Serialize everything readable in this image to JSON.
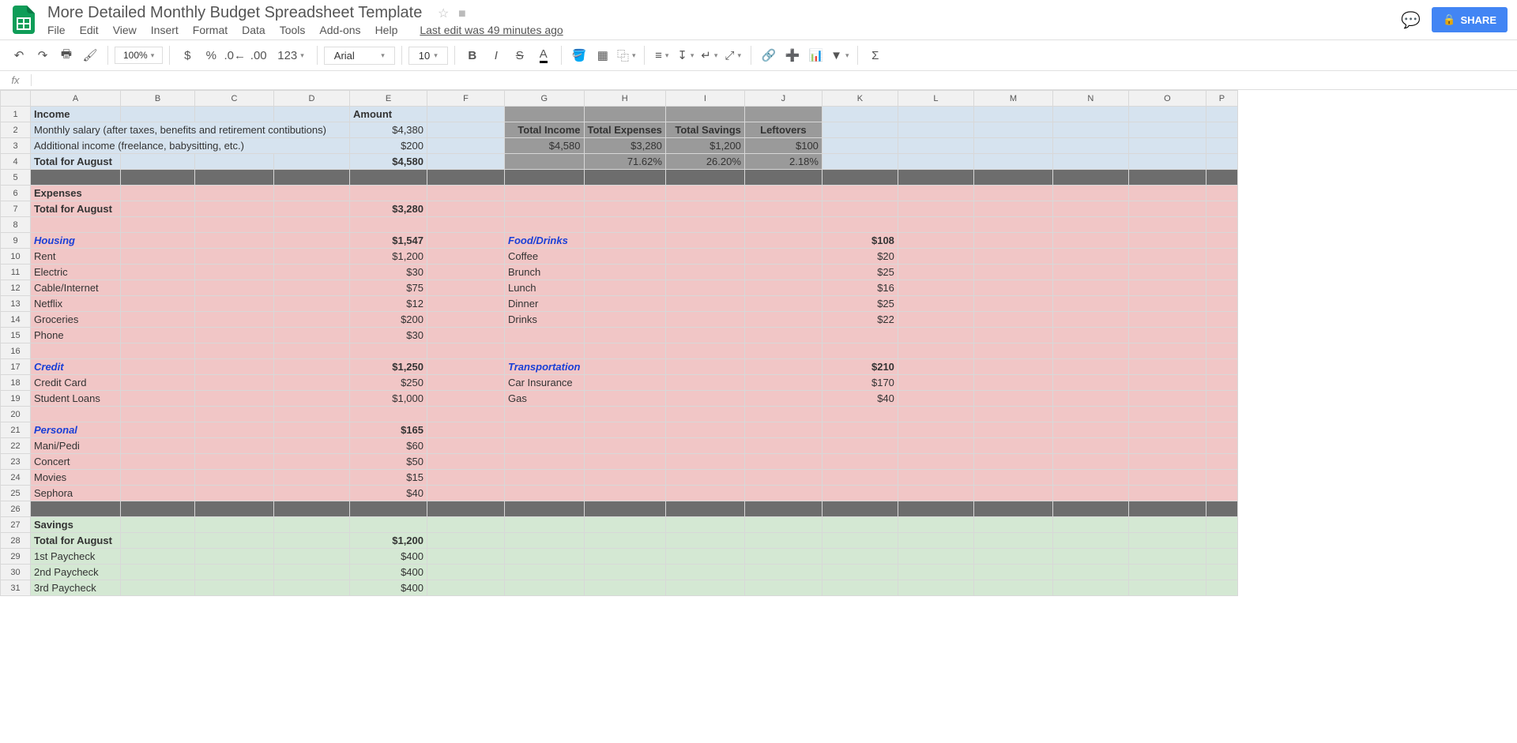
{
  "doc": {
    "title": "More Detailed Monthly Budget Spreadsheet Template",
    "last_edit": "Last edit was 49 minutes ago"
  },
  "menus": [
    "File",
    "Edit",
    "View",
    "Insert",
    "Format",
    "Data",
    "Tools",
    "Add-ons",
    "Help"
  ],
  "share": {
    "label": "SHARE"
  },
  "toolbar": {
    "zoom": "100%",
    "font": "Arial",
    "size": "10",
    "numfmt": "123"
  },
  "columns": [
    "A",
    "B",
    "C",
    "D",
    "E",
    "F",
    "G",
    "H",
    "I",
    "J",
    "K",
    "L",
    "M",
    "N",
    "O",
    "P"
  ],
  "rows": [
    {
      "n": 1,
      "bg": "blue",
      "cells": {
        "A": {
          "t": "Income",
          "cls": "bold"
        },
        "E": {
          "t": "Amount",
          "cls": "bold"
        },
        "G": {
          "bg": "gray"
        },
        "H": {
          "bg": "gray"
        },
        "I": {
          "bg": "gray"
        },
        "J": {
          "bg": "gray"
        }
      }
    },
    {
      "n": 2,
      "bg": "blue",
      "cells": {
        "A": {
          "t": "Monthly salary (after taxes, benefits and retirement contibutions)",
          "span": 4
        },
        "E": {
          "t": "$4,380",
          "cls": "right"
        },
        "G": {
          "t": "Total Income",
          "cls": "bold right",
          "bg": "gray"
        },
        "H": {
          "t": "Total Expenses",
          "cls": "bold right",
          "bg": "gray"
        },
        "I": {
          "t": "Total Savings",
          "cls": "bold right",
          "bg": "gray"
        },
        "J": {
          "t": "Leftovers",
          "cls": "bold center",
          "bg": "gray"
        }
      }
    },
    {
      "n": 3,
      "bg": "blue",
      "cells": {
        "A": {
          "t": "Additional income (freelance, babysitting, etc.)",
          "span": 4
        },
        "E": {
          "t": "$200",
          "cls": "right"
        },
        "G": {
          "t": "$4,580",
          "cls": "right",
          "bg": "gray"
        },
        "H": {
          "t": "$3,280",
          "cls": "right",
          "bg": "gray"
        },
        "I": {
          "t": "$1,200",
          "cls": "right",
          "bg": "gray"
        },
        "J": {
          "t": "$100",
          "cls": "right",
          "bg": "gray"
        }
      }
    },
    {
      "n": 4,
      "bg": "blue",
      "cells": {
        "A": {
          "t": "Total for August",
          "cls": "bold"
        },
        "E": {
          "t": "$4,580",
          "cls": "bold right"
        },
        "G": {
          "bg": "gray"
        },
        "H": {
          "t": "71.62%",
          "cls": "right",
          "bg": "gray"
        },
        "I": {
          "t": "26.20%",
          "cls": "right",
          "bg": "gray"
        },
        "J": {
          "t": "2.18%",
          "cls": "right",
          "bg": "gray"
        }
      }
    },
    {
      "n": 5,
      "bg": "darkgray",
      "cells": {}
    },
    {
      "n": 6,
      "bg": "pink",
      "cells": {
        "A": {
          "t": "Expenses",
          "cls": "bold"
        }
      }
    },
    {
      "n": 7,
      "bg": "pink",
      "cells": {
        "A": {
          "t": "Total for August",
          "cls": "bold"
        },
        "E": {
          "t": "$3,280",
          "cls": "bold right"
        }
      }
    },
    {
      "n": 8,
      "bg": "pink",
      "cells": {}
    },
    {
      "n": 9,
      "bg": "pink",
      "cells": {
        "A": {
          "t": "Housing",
          "cls": "bold italic txt-blue"
        },
        "E": {
          "t": "$1,547",
          "cls": "bold right"
        },
        "G": {
          "t": "Food/Drinks",
          "cls": "bold italic txt-blue"
        },
        "K": {
          "t": "$108",
          "cls": "bold right"
        }
      }
    },
    {
      "n": 10,
      "bg": "pink",
      "cells": {
        "A": {
          "t": "Rent"
        },
        "E": {
          "t": "$1,200",
          "cls": "right"
        },
        "G": {
          "t": "Coffee"
        },
        "K": {
          "t": "$20",
          "cls": "right"
        }
      }
    },
    {
      "n": 11,
      "bg": "pink",
      "cells": {
        "A": {
          "t": "Electric"
        },
        "E": {
          "t": "$30",
          "cls": "right"
        },
        "G": {
          "t": "Brunch"
        },
        "K": {
          "t": "$25",
          "cls": "right"
        }
      }
    },
    {
      "n": 12,
      "bg": "pink",
      "cells": {
        "A": {
          "t": "Cable/Internet"
        },
        "E": {
          "t": "$75",
          "cls": "right"
        },
        "G": {
          "t": "Lunch"
        },
        "K": {
          "t": "$16",
          "cls": "right"
        }
      }
    },
    {
      "n": 13,
      "bg": "pink",
      "cells": {
        "A": {
          "t": "Netflix"
        },
        "E": {
          "t": "$12",
          "cls": "right"
        },
        "G": {
          "t": "Dinner"
        },
        "K": {
          "t": "$25",
          "cls": "right"
        }
      }
    },
    {
      "n": 14,
      "bg": "pink",
      "cells": {
        "A": {
          "t": "Groceries"
        },
        "E": {
          "t": "$200",
          "cls": "right"
        },
        "G": {
          "t": "Drinks"
        },
        "K": {
          "t": "$22",
          "cls": "right"
        }
      }
    },
    {
      "n": 15,
      "bg": "pink",
      "cells": {
        "A": {
          "t": "Phone"
        },
        "E": {
          "t": "$30",
          "cls": "right"
        }
      }
    },
    {
      "n": 16,
      "bg": "pink",
      "cells": {}
    },
    {
      "n": 17,
      "bg": "pink",
      "cells": {
        "A": {
          "t": "Credit",
          "cls": "bold italic txt-blue"
        },
        "E": {
          "t": "$1,250",
          "cls": "bold right"
        },
        "G": {
          "t": "Transportation",
          "cls": "bold italic txt-blue"
        },
        "K": {
          "t": "$210",
          "cls": "bold right"
        }
      }
    },
    {
      "n": 18,
      "bg": "pink",
      "cells": {
        "A": {
          "t": "Credit Card"
        },
        "E": {
          "t": "$250",
          "cls": "right"
        },
        "G": {
          "t": "Car Insurance"
        },
        "K": {
          "t": "$170",
          "cls": "right"
        }
      }
    },
    {
      "n": 19,
      "bg": "pink",
      "cells": {
        "A": {
          "t": "Student Loans"
        },
        "E": {
          "t": "$1,000",
          "cls": "right"
        },
        "G": {
          "t": "Gas"
        },
        "K": {
          "t": "$40",
          "cls": "right"
        }
      }
    },
    {
      "n": 20,
      "bg": "pink",
      "cells": {}
    },
    {
      "n": 21,
      "bg": "pink",
      "cells": {
        "A": {
          "t": "Personal",
          "cls": "bold italic txt-blue"
        },
        "E": {
          "t": "$165",
          "cls": "bold right"
        }
      }
    },
    {
      "n": 22,
      "bg": "pink",
      "cells": {
        "A": {
          "t": "Mani/Pedi"
        },
        "E": {
          "t": "$60",
          "cls": "right"
        }
      }
    },
    {
      "n": 23,
      "bg": "pink",
      "cells": {
        "A": {
          "t": "Concert"
        },
        "E": {
          "t": "$50",
          "cls": "right"
        }
      }
    },
    {
      "n": 24,
      "bg": "pink",
      "cells": {
        "A": {
          "t": "Movies"
        },
        "E": {
          "t": "$15",
          "cls": "right"
        }
      }
    },
    {
      "n": 25,
      "bg": "pink",
      "cells": {
        "A": {
          "t": "Sephora"
        },
        "E": {
          "t": "$40",
          "cls": "right"
        }
      }
    },
    {
      "n": 26,
      "bg": "darkgray",
      "cells": {}
    },
    {
      "n": 27,
      "bg": "green",
      "cells": {
        "A": {
          "t": "Savings",
          "cls": "bold"
        }
      }
    },
    {
      "n": 28,
      "bg": "green",
      "cells": {
        "A": {
          "t": "Total for August",
          "cls": "bold"
        },
        "E": {
          "t": "$1,200",
          "cls": "bold right"
        }
      }
    },
    {
      "n": 29,
      "bg": "green",
      "cells": {
        "A": {
          "t": "1st Paycheck"
        },
        "E": {
          "t": "$400",
          "cls": "right"
        }
      }
    },
    {
      "n": 30,
      "bg": "green",
      "cells": {
        "A": {
          "t": "2nd Paycheck"
        },
        "E": {
          "t": "$400",
          "cls": "right"
        }
      }
    },
    {
      "n": 31,
      "bg": "green",
      "cells": {
        "A": {
          "t": "3rd Paycheck"
        },
        "E": {
          "t": "$400",
          "cls": "right"
        }
      }
    }
  ]
}
